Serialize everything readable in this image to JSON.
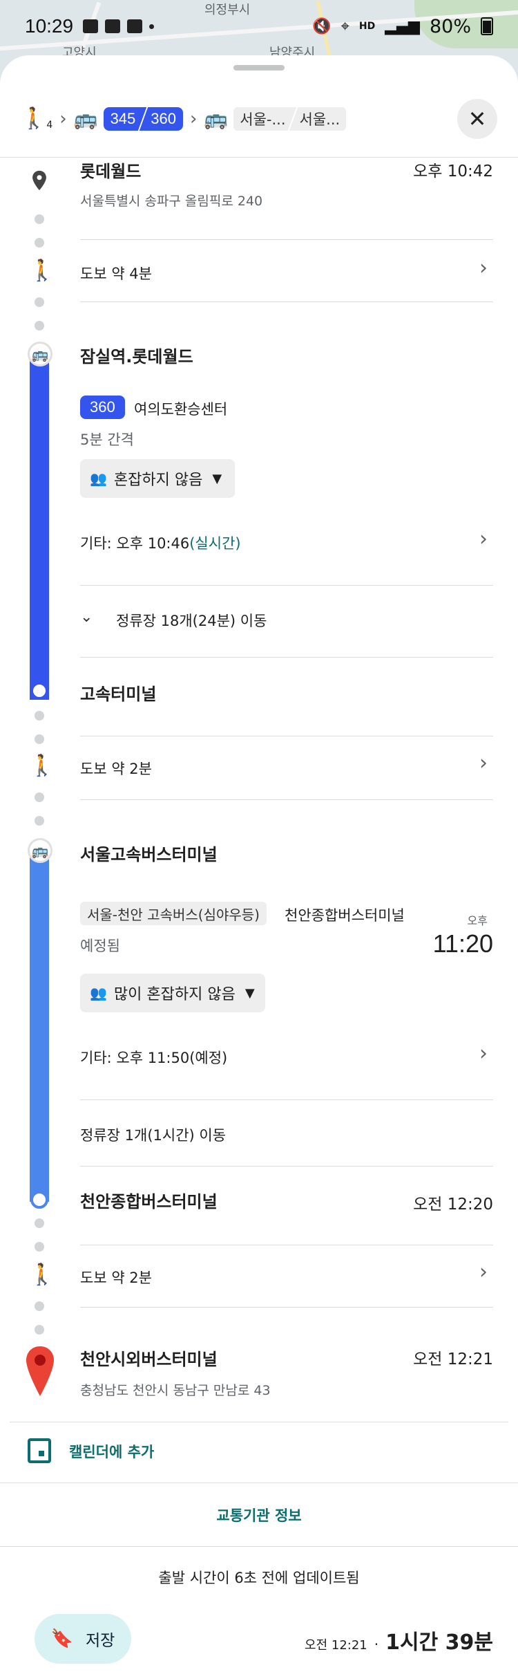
{
  "status": {
    "time": "10:29",
    "battery": "80%",
    "network": "HD"
  },
  "map_labels": [
    "의정부시",
    "고양시",
    "남양주시"
  ],
  "header": {
    "walk_minutes": "4",
    "bus_chips": [
      "345",
      "360"
    ],
    "intercity_chips": [
      "서울-...",
      "서울..."
    ]
  },
  "stops": {
    "origin": {
      "name": "롯데월드",
      "address": "서울특별시 송파구 올림픽로 240",
      "time": "오후 10:42"
    },
    "walk1": "도보 약 4분",
    "bus_stop1": {
      "name": "잠실역.롯데월드",
      "route": "360",
      "destination": "여의도환승센터",
      "interval": "5분 간격",
      "crowd": "혼잡하지 않음",
      "other": "기타: 오후 10:46",
      "other_note": "(실시간)",
      "stops_info": "정류장 18개(24분) 이동"
    },
    "alight1": "고속터미널",
    "walk2": "도보 약 2분",
    "bus_stop2": {
      "name": "서울고속버스터미널",
      "route": "서울-천안 고속버스(심야우등)",
      "destination": "천안종합버스터미널",
      "status": "예정됨",
      "depart_period": "오후",
      "depart_time": "11:20",
      "crowd": "많이 혼잡하지 않음",
      "other": "기타: 오후 11:50(예정)",
      "stops_info": "정류장 1개(1시간) 이동"
    },
    "alight2": {
      "name": "천안종합버스터미널",
      "time": "오전 12:20"
    },
    "walk3": "도보 약 2분",
    "destination": {
      "name": "천안시외버스터미널",
      "address": "충청남도 천안시 동남구 만남로 43",
      "time": "오전 12:21"
    }
  },
  "actions": {
    "calendar": "캘린더에 추가",
    "transit_info": "교통기관 정보",
    "updated": "출발 시간이 6초 전에 업데이트됨",
    "save": "저장",
    "arrival": "오전 12:21",
    "separator": "·",
    "duration": "1시간 39분"
  },
  "colors": {
    "route_blue": "#3355ee",
    "intercity_blue": "#4a86ec",
    "pin_red": "#ea4335",
    "teal": "#0b6e6e"
  }
}
